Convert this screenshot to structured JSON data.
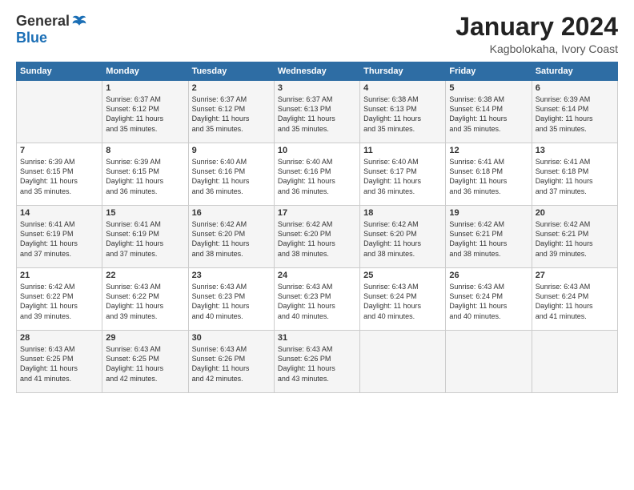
{
  "logo": {
    "general": "General",
    "blue": "Blue"
  },
  "title": "January 2024",
  "subtitle": "Kagbolokaha, Ivory Coast",
  "header_days": [
    "Sunday",
    "Monday",
    "Tuesday",
    "Wednesday",
    "Thursday",
    "Friday",
    "Saturday"
  ],
  "weeks": [
    [
      {
        "day": "",
        "lines": []
      },
      {
        "day": "1",
        "lines": [
          "Sunrise: 6:37 AM",
          "Sunset: 6:12 PM",
          "Daylight: 11 hours",
          "and 35 minutes."
        ]
      },
      {
        "day": "2",
        "lines": [
          "Sunrise: 6:37 AM",
          "Sunset: 6:12 PM",
          "Daylight: 11 hours",
          "and 35 minutes."
        ]
      },
      {
        "day": "3",
        "lines": [
          "Sunrise: 6:37 AM",
          "Sunset: 6:13 PM",
          "Daylight: 11 hours",
          "and 35 minutes."
        ]
      },
      {
        "day": "4",
        "lines": [
          "Sunrise: 6:38 AM",
          "Sunset: 6:13 PM",
          "Daylight: 11 hours",
          "and 35 minutes."
        ]
      },
      {
        "day": "5",
        "lines": [
          "Sunrise: 6:38 AM",
          "Sunset: 6:14 PM",
          "Daylight: 11 hours",
          "and 35 minutes."
        ]
      },
      {
        "day": "6",
        "lines": [
          "Sunrise: 6:39 AM",
          "Sunset: 6:14 PM",
          "Daylight: 11 hours",
          "and 35 minutes."
        ]
      }
    ],
    [
      {
        "day": "7",
        "lines": [
          "Sunrise: 6:39 AM",
          "Sunset: 6:15 PM",
          "Daylight: 11 hours",
          "and 35 minutes."
        ]
      },
      {
        "day": "8",
        "lines": [
          "Sunrise: 6:39 AM",
          "Sunset: 6:15 PM",
          "Daylight: 11 hours",
          "and 36 minutes."
        ]
      },
      {
        "day": "9",
        "lines": [
          "Sunrise: 6:40 AM",
          "Sunset: 6:16 PM",
          "Daylight: 11 hours",
          "and 36 minutes."
        ]
      },
      {
        "day": "10",
        "lines": [
          "Sunrise: 6:40 AM",
          "Sunset: 6:16 PM",
          "Daylight: 11 hours",
          "and 36 minutes."
        ]
      },
      {
        "day": "11",
        "lines": [
          "Sunrise: 6:40 AM",
          "Sunset: 6:17 PM",
          "Daylight: 11 hours",
          "and 36 minutes."
        ]
      },
      {
        "day": "12",
        "lines": [
          "Sunrise: 6:41 AM",
          "Sunset: 6:18 PM",
          "Daylight: 11 hours",
          "and 36 minutes."
        ]
      },
      {
        "day": "13",
        "lines": [
          "Sunrise: 6:41 AM",
          "Sunset: 6:18 PM",
          "Daylight: 11 hours",
          "and 37 minutes."
        ]
      }
    ],
    [
      {
        "day": "14",
        "lines": [
          "Sunrise: 6:41 AM",
          "Sunset: 6:19 PM",
          "Daylight: 11 hours",
          "and 37 minutes."
        ]
      },
      {
        "day": "15",
        "lines": [
          "Sunrise: 6:41 AM",
          "Sunset: 6:19 PM",
          "Daylight: 11 hours",
          "and 37 minutes."
        ]
      },
      {
        "day": "16",
        "lines": [
          "Sunrise: 6:42 AM",
          "Sunset: 6:20 PM",
          "Daylight: 11 hours",
          "and 38 minutes."
        ]
      },
      {
        "day": "17",
        "lines": [
          "Sunrise: 6:42 AM",
          "Sunset: 6:20 PM",
          "Daylight: 11 hours",
          "and 38 minutes."
        ]
      },
      {
        "day": "18",
        "lines": [
          "Sunrise: 6:42 AM",
          "Sunset: 6:20 PM",
          "Daylight: 11 hours",
          "and 38 minutes."
        ]
      },
      {
        "day": "19",
        "lines": [
          "Sunrise: 6:42 AM",
          "Sunset: 6:21 PM",
          "Daylight: 11 hours",
          "and 38 minutes."
        ]
      },
      {
        "day": "20",
        "lines": [
          "Sunrise: 6:42 AM",
          "Sunset: 6:21 PM",
          "Daylight: 11 hours",
          "and 39 minutes."
        ]
      }
    ],
    [
      {
        "day": "21",
        "lines": [
          "Sunrise: 6:42 AM",
          "Sunset: 6:22 PM",
          "Daylight: 11 hours",
          "and 39 minutes."
        ]
      },
      {
        "day": "22",
        "lines": [
          "Sunrise: 6:43 AM",
          "Sunset: 6:22 PM",
          "Daylight: 11 hours",
          "and 39 minutes."
        ]
      },
      {
        "day": "23",
        "lines": [
          "Sunrise: 6:43 AM",
          "Sunset: 6:23 PM",
          "Daylight: 11 hours",
          "and 40 minutes."
        ]
      },
      {
        "day": "24",
        "lines": [
          "Sunrise: 6:43 AM",
          "Sunset: 6:23 PM",
          "Daylight: 11 hours",
          "and 40 minutes."
        ]
      },
      {
        "day": "25",
        "lines": [
          "Sunrise: 6:43 AM",
          "Sunset: 6:24 PM",
          "Daylight: 11 hours",
          "and 40 minutes."
        ]
      },
      {
        "day": "26",
        "lines": [
          "Sunrise: 6:43 AM",
          "Sunset: 6:24 PM",
          "Daylight: 11 hours",
          "and 40 minutes."
        ]
      },
      {
        "day": "27",
        "lines": [
          "Sunrise: 6:43 AM",
          "Sunset: 6:24 PM",
          "Daylight: 11 hours",
          "and 41 minutes."
        ]
      }
    ],
    [
      {
        "day": "28",
        "lines": [
          "Sunrise: 6:43 AM",
          "Sunset: 6:25 PM",
          "Daylight: 11 hours",
          "and 41 minutes."
        ]
      },
      {
        "day": "29",
        "lines": [
          "Sunrise: 6:43 AM",
          "Sunset: 6:25 PM",
          "Daylight: 11 hours",
          "and 42 minutes."
        ]
      },
      {
        "day": "30",
        "lines": [
          "Sunrise: 6:43 AM",
          "Sunset: 6:26 PM",
          "Daylight: 11 hours",
          "and 42 minutes."
        ]
      },
      {
        "day": "31",
        "lines": [
          "Sunrise: 6:43 AM",
          "Sunset: 6:26 PM",
          "Daylight: 11 hours",
          "and 43 minutes."
        ]
      },
      {
        "day": "",
        "lines": []
      },
      {
        "day": "",
        "lines": []
      },
      {
        "day": "",
        "lines": []
      }
    ]
  ]
}
